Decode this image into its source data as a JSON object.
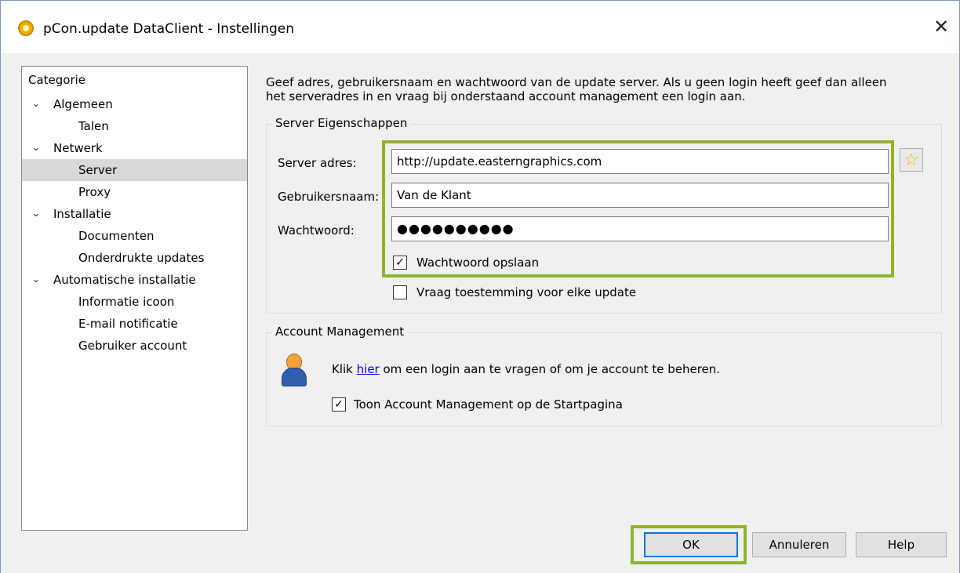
{
  "window": {
    "title": "pCon.update DataClient - Instellingen",
    "close_glyph": "✕"
  },
  "tree": {
    "header": "Categorie",
    "expand_glyph": "⌄",
    "items": [
      {
        "label": "Algemeen",
        "level": 1,
        "expanded": true
      },
      {
        "label": "Talen",
        "level": 2
      },
      {
        "label": "Netwerk",
        "level": 1,
        "expanded": true
      },
      {
        "label": "Server",
        "level": 2,
        "selected": true
      },
      {
        "label": "Proxy",
        "level": 2
      },
      {
        "label": "Installatie",
        "level": 1,
        "expanded": true
      },
      {
        "label": "Documenten",
        "level": 2
      },
      {
        "label": "Onderdrukte updates",
        "level": 2
      },
      {
        "label": "Automatische installatie",
        "level": 1,
        "expanded": true
      },
      {
        "label": "Informatie icoon",
        "level": 2
      },
      {
        "label": "E-mail notificatie",
        "level": 2
      },
      {
        "label": "Gebruiker account",
        "level": 2
      }
    ]
  },
  "description": {
    "line1": "Geef adres, gebruikersnaam en wachtwoord van de update server. Als u geen login heeft geef dan alleen",
    "line2": "het serveradres in en vraag bij onderstaand account management een login aan."
  },
  "server_group": {
    "title": "Server Eigenschappen",
    "server_label": "Server adres:",
    "server_value": "http://update.easterngraphics.com",
    "username_label": "Gebruikersnaam:",
    "username_value": "Van de Klant",
    "password_label": "Wachtwoord:",
    "password_value": "●●●●●●●●●●",
    "save_password_label": "Wachtwoord opslaan",
    "save_password_checked": true,
    "ask_permission_label": "Vraag toestemming voor elke update",
    "ask_permission_checked": false,
    "favorite_icon": "star-icon",
    "star_glyph": "☆"
  },
  "account_group": {
    "title": "Account Management",
    "text_before": "Klik ",
    "link_text": "hier",
    "text_after": " om een login aan te vragen of om je account te beheren.",
    "show_on_start_label": "Toon Account  Management op de Startpagina",
    "show_on_start_checked": true
  },
  "check_glyph": "✓",
  "buttons": {
    "ok": "OK",
    "cancel": "Annuleren",
    "help": "Help"
  },
  "colors": {
    "highlight": "#8db42c",
    "default_button_border": "#0078d7",
    "link": "#0000ee",
    "selection": "#d9d9d9"
  }
}
